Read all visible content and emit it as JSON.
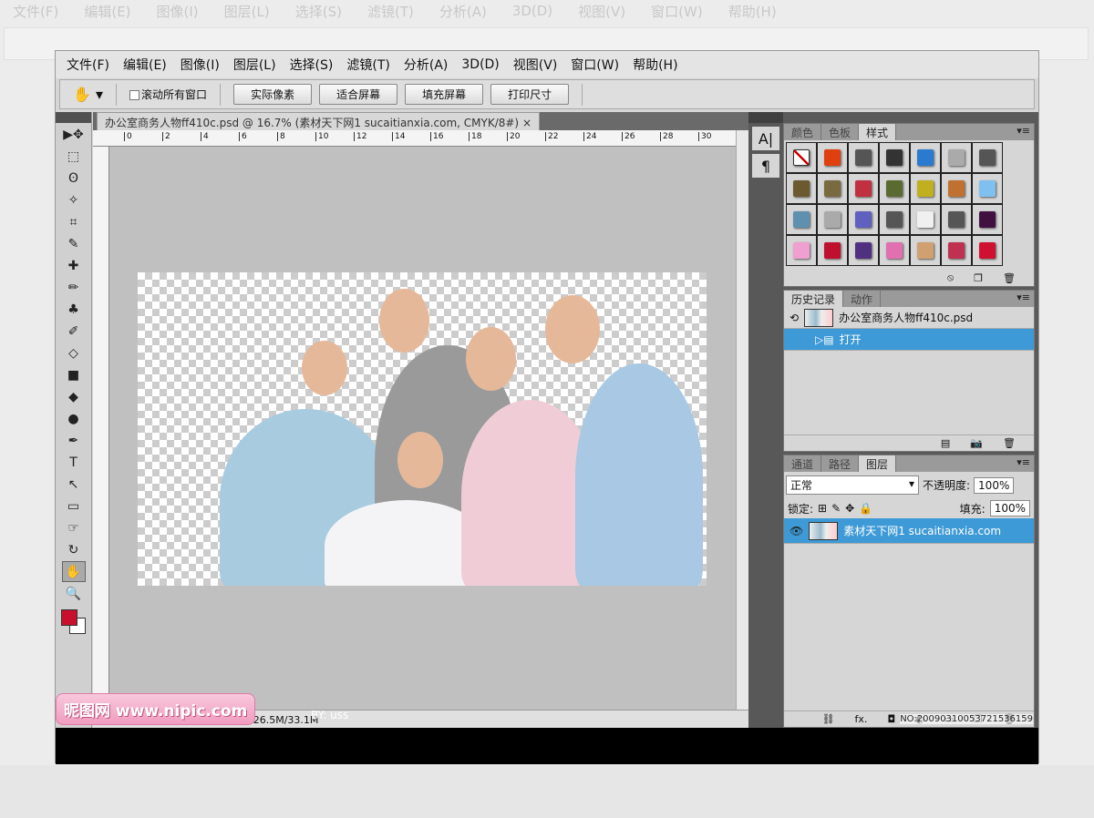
{
  "menu": [
    "文件(F)",
    "编辑(E)",
    "图像(I)",
    "图层(L)",
    "选择(S)",
    "滤镜(T)",
    "分析(A)",
    "3D(D)",
    "视图(V)",
    "窗口(W)",
    "帮助(H)"
  ],
  "options": {
    "scroll_all": "滚动所有窗口",
    "buttons": [
      "实际像素",
      "适合屏幕",
      "填充屏幕",
      "打印尺寸"
    ]
  },
  "document": {
    "tab_title": "办公室商务人物ff410c.psd @ 16.7% (素材天下网1 sucaitianxia.com, CMYK/8#)",
    "close": "×",
    "ruler_ticks": [
      "0",
      "2",
      "4",
      "6",
      "8",
      "10",
      "12",
      "14",
      "16",
      "18",
      "20",
      "22",
      "24",
      "26",
      "28",
      "30"
    ],
    "status": "文档:26.5M/33.1M"
  },
  "tools": [
    "▶✥",
    "⬚",
    "ʘ",
    "✧",
    "⌗",
    "✎",
    "✚",
    "✏",
    "♣",
    "✐",
    "◇",
    "■",
    "◆",
    "●",
    "✒",
    "T",
    "↖",
    "▭",
    "☞",
    "↻",
    "✋",
    "🔍"
  ],
  "dock": [
    "A|",
    "¶"
  ],
  "styles_panel": {
    "tabs": [
      "颜色",
      "色板",
      "样式"
    ],
    "swatches": [
      "#ffffff",
      "#e04010",
      "#555555",
      "#333333",
      "#2a7ad0",
      "#aaaaaa",
      "#555555",
      "#6b5a30",
      "#7a6a40",
      "#c03040",
      "#5a6a30",
      "#c0b020",
      "#c07030",
      "#80c0f0",
      "#6090b0",
      "#aaaaaa",
      "#6060c0",
      "#555555",
      "#f0f0f0",
      "#555555",
      "#401040",
      "#f0a0d0",
      "#c01030",
      "#503080",
      "#e070b0",
      "#d0a070",
      "#c03050",
      "#d01030"
    ]
  },
  "history_panel": {
    "tabs": [
      "历史记录",
      "动作"
    ],
    "snapshot": "办公室商务人物ff410c.psd",
    "items": [
      "打开"
    ]
  },
  "layers_panel": {
    "tabs": [
      "通道",
      "路径",
      "图层"
    ],
    "blend_mode": "正常",
    "opacity_label": "不透明度:",
    "opacity": "100%",
    "lock_label": "锁定:",
    "fill_label": "填充:",
    "fill": "100%",
    "layer": "素材天下网1 sucaitianxia.com",
    "footer": [
      "⛓",
      "fx.",
      "◘",
      "◐",
      "▭",
      "❐",
      "🗑"
    ]
  },
  "watermark": {
    "logo": "昵图网 www.nipic.com",
    "by": "BY: uss",
    "id": "NO:20090310053721536159"
  },
  "colors": {
    "accent": "#3e9ad6",
    "foreground": "#c8102e",
    "background": "#ffffff"
  }
}
